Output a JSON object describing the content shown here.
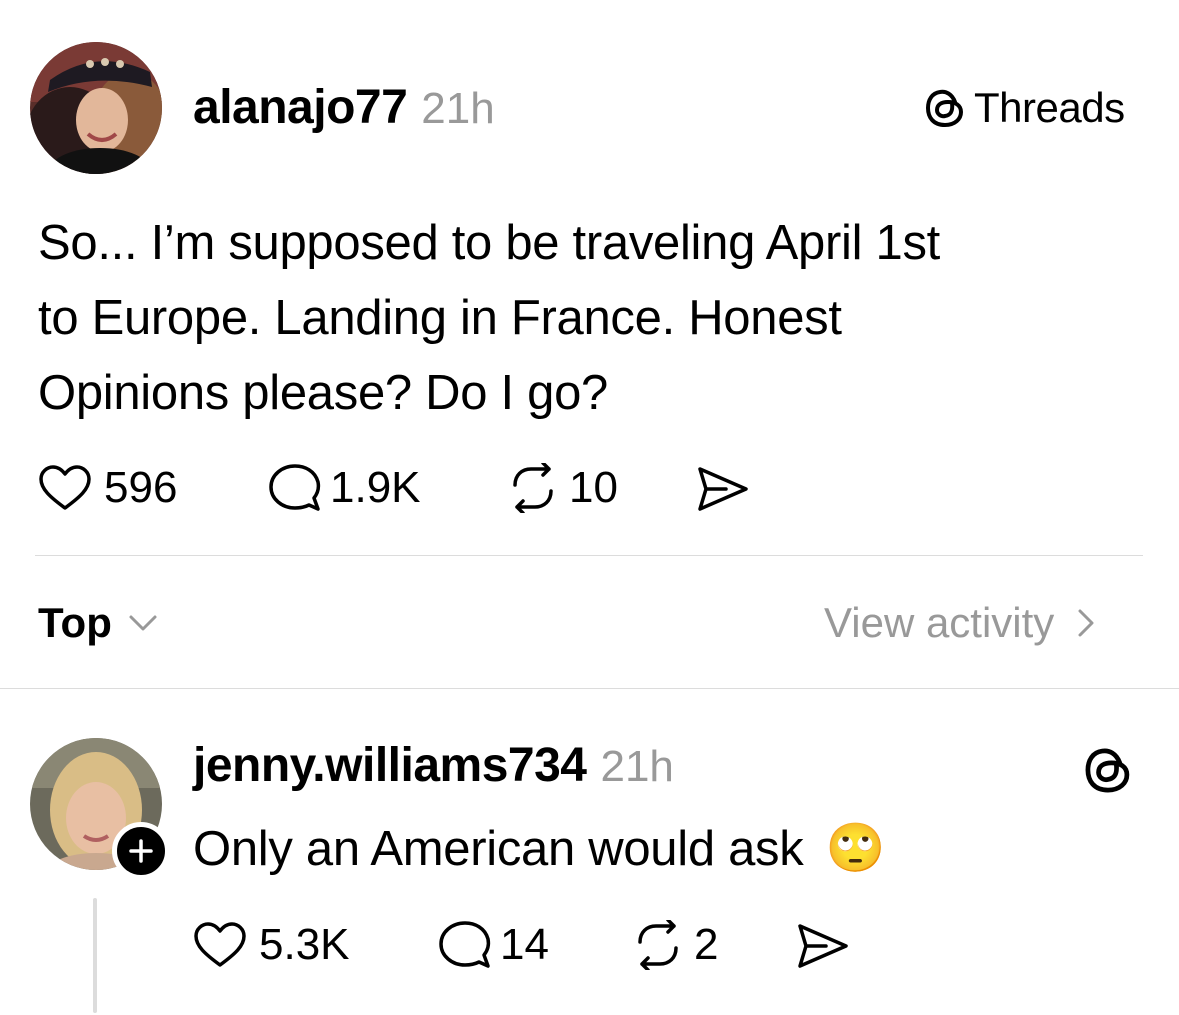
{
  "post": {
    "username": "alanajo77",
    "time": "21h",
    "text_line1": "So... I’m supposed to be traveling April 1st",
    "text_line2": "to Europe. Landing in France. Honest",
    "text_line3": "Opinions please? Do I go?",
    "likes": "596",
    "replies": "1.9K",
    "reposts": "10",
    "threads_label": "Threads"
  },
  "sort": {
    "label": "Top",
    "view_activity": "View activity"
  },
  "reply": {
    "username": "jenny.williams734",
    "time": "21h",
    "text": "Only an American would ask",
    "emoji": "🙄",
    "likes": "5.3K",
    "replies": "14",
    "reposts": "2"
  },
  "icons": {
    "like": "heart-icon",
    "reply": "comment-icon",
    "repost": "repost-icon",
    "share": "send-icon",
    "threads": "threads-logo-icon",
    "follow": "plus-icon",
    "chevron_down": "chevron-down-icon",
    "chevron_right": "chevron-right-icon"
  },
  "colors": {
    "text": "#000000",
    "secondary": "#999999",
    "divider": "#dcdcdc"
  }
}
